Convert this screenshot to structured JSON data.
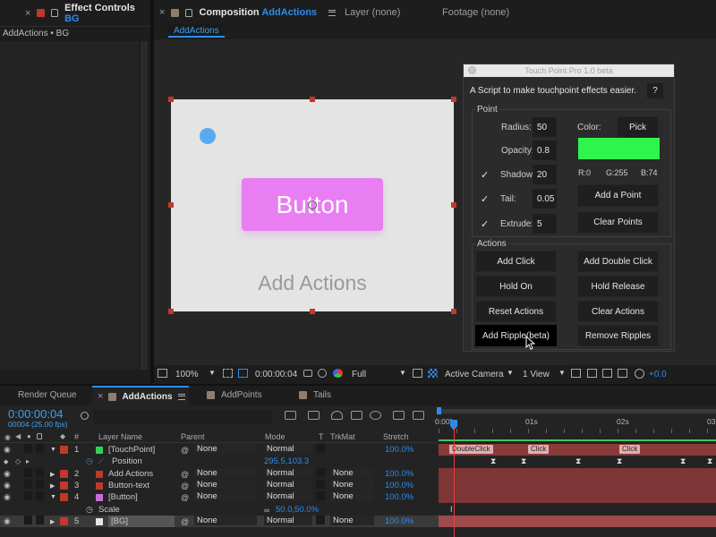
{
  "effect_panel": {
    "tab_label": "Effect Controls",
    "tab_layer": "BG",
    "breadcrumb": "AddActions • BG"
  },
  "composition_panel": {
    "tab_label": "Composition",
    "tab_comp": "AddActions",
    "layer_tab": "Layer (none)",
    "footage_tab": "Footage (none)",
    "comp_chip": "AddActions"
  },
  "canvas": {
    "button_text": "Button",
    "caption": "Add Actions",
    "dot_color": "#5aaaf0",
    "button_color": "#e87ef2"
  },
  "viewer_bar": {
    "zoom": "100%",
    "timecode": "0:00:00:04",
    "resolution": "Full",
    "camera": "Active Camera",
    "view": "1 View",
    "exposure": "+0.0"
  },
  "touchpoint": {
    "title": "Touch Point Pro 1.0 beta",
    "description": "A Script to make touchpoint effects easier.",
    "help_label": "?",
    "point_group_label": "Point",
    "radius_label": "Radius:",
    "radius_value": "50",
    "opacity_label": "Opacity:",
    "opacity_value": "0.8",
    "shadow_label": "Shadow:",
    "shadow_value": "20",
    "tail_label": "Tail:",
    "tail_value": "0.05",
    "extrude_label": "Extrude:",
    "extrude_value": "5",
    "check_mark": "✓",
    "color_label": "Color:",
    "pick_label": "Pick",
    "swatch_color": "#2ef54e",
    "rgb": {
      "r": "R:0",
      "g": "G:255",
      "b": "B:74"
    },
    "add_point": "Add a Point",
    "clear_points": "Clear Points",
    "actions_group_label": "Actions",
    "actions": {
      "add_click": "Add Click",
      "add_double_click": "Add Double Click",
      "hold_on": "Hold On",
      "hold_release": "Hold Release",
      "reset_actions": "Reset Actions",
      "clear_actions": "Clear Actions",
      "add_ripple": "Add Ripple(beta)",
      "remove_ripples": "Remove Ripples"
    }
  },
  "bottom_tabs": {
    "render_queue": "Render Queue",
    "add_actions": "AddActions",
    "add_points": "AddPoints",
    "tails": "Tails"
  },
  "timeline": {
    "timecode": "0:00:00:04",
    "frame_info": "00004 (25.00 fps)",
    "headers": {
      "num": "#",
      "layer_name": "Layer Name",
      "parent": "Parent",
      "mode": "Mode",
      "t": "T",
      "trkmat": "TrkMat",
      "stretch": "Stretch"
    },
    "ruler": [
      "0:00f",
      "01s",
      "02s",
      "03s"
    ],
    "layers": [
      {
        "num": "1",
        "name": "[TouchPoint]",
        "color": "#2fd15a",
        "parent": "None",
        "mode": "Normal",
        "trkmat": "",
        "stretch": "100.0%"
      },
      {
        "num": "2",
        "name": "Add Actions",
        "color": "#c0392b",
        "parent": "None",
        "mode": "Normal",
        "trkmat": "None",
        "stretch": "100.0%"
      },
      {
        "num": "3",
        "name": "Button-text",
        "color": "#c0392b",
        "parent": "None",
        "mode": "Normal",
        "trkmat": "None",
        "stretch": "100.0%"
      },
      {
        "num": "4",
        "name": "[Button]",
        "color": "#c96cd8",
        "parent": "None",
        "mode": "Normal",
        "trkmat": "None",
        "stretch": "100.0%"
      },
      {
        "num": "5",
        "name": "[BG]",
        "color": "#e5e5e5",
        "parent": "None",
        "mode": "Normal",
        "trkmat": "None",
        "stretch": "100.0%"
      }
    ],
    "position_label": "Position",
    "position_value": "295.5,103.3",
    "scale_label": "Scale",
    "scale_value": "50.0,50.0%",
    "markers": [
      "DoubleClick",
      "Click",
      "Click"
    ]
  }
}
